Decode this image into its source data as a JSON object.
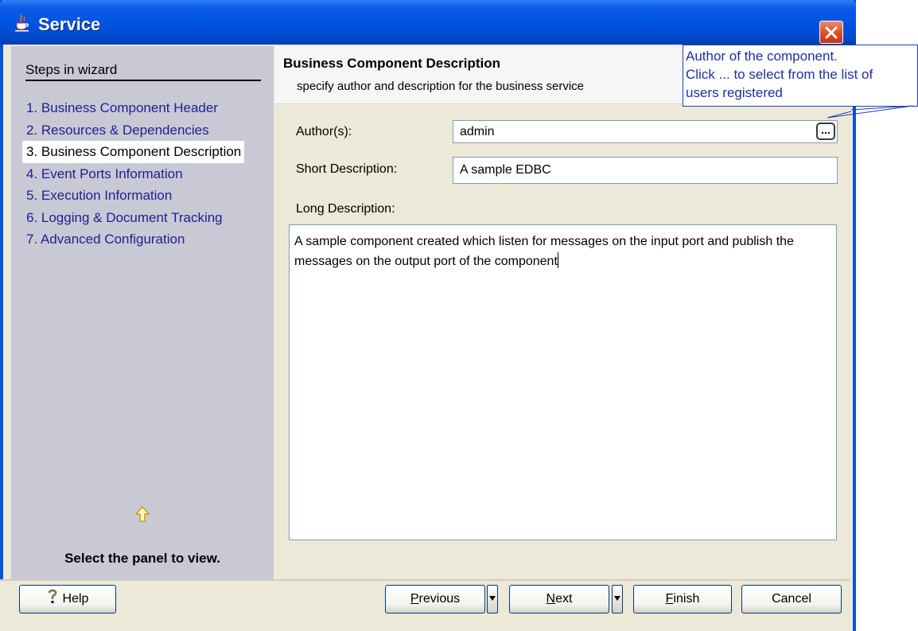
{
  "window": {
    "title": "Service",
    "icon": "java-cup-icon",
    "close_icon": "close-icon"
  },
  "steps": {
    "heading": "Steps in wizard",
    "items": [
      {
        "label": "1. Business Component Header"
      },
      {
        "label": "2. Resources & Dependencies"
      },
      {
        "label": "3. Business Component Description",
        "active": true
      },
      {
        "label": "4. Event Ports Information"
      },
      {
        "label": "5. Execution Information"
      },
      {
        "label": "6. Logging & Document Tracking"
      },
      {
        "label": "7. Advanced Configuration"
      }
    ],
    "hint_icon": "up-arrow-icon",
    "hint": "Select the panel to view."
  },
  "header": {
    "title": "Business Component Description",
    "subtitle": "specify author and description for the business service"
  },
  "tooltip": {
    "lines": [
      "Author of the component.",
      "Click ... to select from the list of",
      "users registered"
    ]
  },
  "form": {
    "author_label": "Author(s):",
    "author_value": "admin",
    "author_browse_label": "...",
    "short_label": "Short Description:",
    "short_value": "A sample EDBC",
    "long_label": "Long Description:",
    "long_value": "A sample component created which listen for messages on the input port and publish the messages on the output port of the component"
  },
  "buttons": {
    "help": "Help",
    "previous": {
      "mnemonic": "P",
      "rest": "revious"
    },
    "next": {
      "mnemonic": "N",
      "rest": "ext"
    },
    "finish": {
      "mnemonic": "F",
      "rest": "inish"
    },
    "cancel": "Cancel"
  },
  "colors": {
    "title_bar": "#0054e3",
    "steps_panel": "#c9c8d5",
    "step_text": "#1f1f8f",
    "tooltip_text": "#1f2fa0",
    "dialog_bg": "#ece9d8"
  }
}
